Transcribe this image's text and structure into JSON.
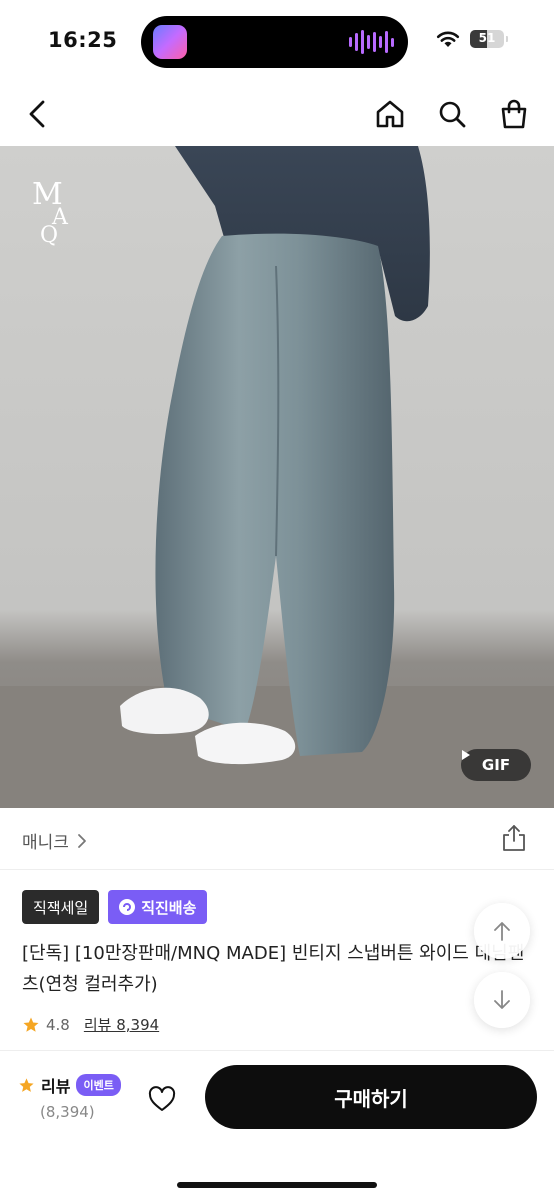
{
  "status_bar": {
    "time": "16:25",
    "battery_level": "51",
    "battery_fraction": 0.51,
    "icons": [
      "wifi-icon",
      "battery-icon"
    ]
  },
  "nav": {
    "icons": [
      "back-arrow-icon",
      "home-icon",
      "search-icon",
      "shopping-bag-icon"
    ]
  },
  "hero": {
    "logo_text": "MNQ",
    "gif_label": "GIF"
  },
  "brand": {
    "name": "매니크",
    "share_icon": "share-icon"
  },
  "badges": {
    "sale_label": "직잭세일",
    "delivery_label": "직진배송"
  },
  "product": {
    "title": "[단독] [10만장판매/MNQ MADE] 빈티지 스냅버튼 와이드 데님팬츠(연청 컬러추가)",
    "rating": "4.8",
    "review_link": "리뷰 8,394"
  },
  "bottom_bar": {
    "review_label": "리뷰",
    "event_label": "이벤트",
    "review_count": "(8,394)",
    "buy_label": "구매하기"
  },
  "colors": {
    "accent_purple": "#7a5df5",
    "star_orange": "#f5a623",
    "buy_button": "#0d0d0d"
  }
}
